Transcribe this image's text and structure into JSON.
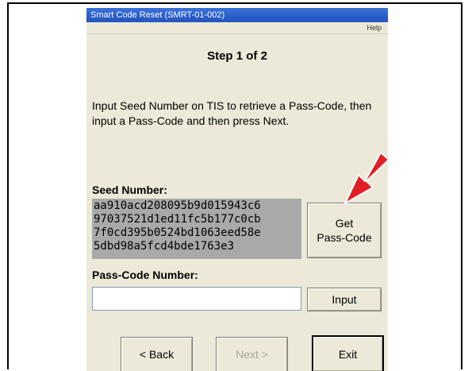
{
  "window": {
    "title": "Smart Code Reset (SMRT-01-002)"
  },
  "menu": {
    "help_label": "Help"
  },
  "step_label": "Step 1 of 2",
  "instructions": "Input Seed Number on TIS to retrieve a Pass-Code, then input a Pass-Code and then press Next.",
  "seed": {
    "label": "Seed Number:",
    "lines": [
      "aa910acd208095b9d015943c6",
      "97037521d1ed11fc5b177c0cb",
      "7f0cd395b0524bd1063eed58e",
      "5dbd98a5fcd4bde1763e3"
    ]
  },
  "get_pass_button": {
    "line1": "Get",
    "line2": "Pass-Code"
  },
  "pass_code": {
    "label": "Pass-Code Number:",
    "value": ""
  },
  "input_button_label": "Input",
  "nav": {
    "back_label": "< Back",
    "next_label": "Next >",
    "exit_label": "Exit"
  },
  "colors": {
    "titlebar": "#2a5cc8",
    "window_bg": "#ece9d8",
    "seed_bg": "#a9a9a9",
    "arrow": "#e31e24"
  }
}
